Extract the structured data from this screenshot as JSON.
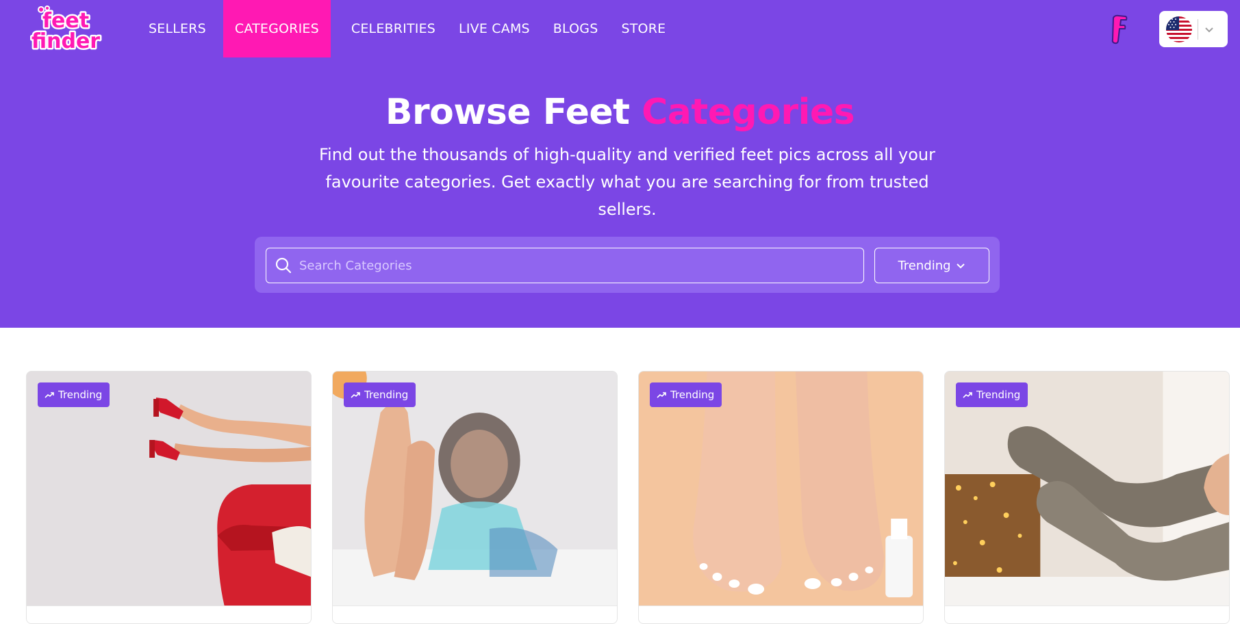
{
  "nav": {
    "logo_text": "feet finder",
    "items": [
      {
        "label": "SELLERS"
      },
      {
        "label": "CATEGORIES",
        "active": true
      },
      {
        "label": "CELEBRITIES"
      },
      {
        "label": "LIVE CAMS"
      },
      {
        "label": "BLOGS"
      },
      {
        "label": "STORE"
      }
    ],
    "language": "US flag"
  },
  "hero": {
    "title_main": "Browse Feet",
    "title_accent": "Categories",
    "subtitle": "Find out the thousands of high-quality and verified feet pics across all your favourite categories. Get exactly what you are searching for from trusted sellers."
  },
  "search": {
    "placeholder": "Search Categories",
    "value": "",
    "sort_label": "Trending"
  },
  "cards": [
    {
      "badge": "Trending",
      "image": "red high heels on red sofa"
    },
    {
      "badge": "Trending",
      "image": "woman relaxing showing soles"
    },
    {
      "badge": "Trending",
      "image": "bare feet with white pedicure"
    },
    {
      "badge": "Trending",
      "image": "feet in knitted wool socks by fireplace"
    }
  ],
  "colors": {
    "brand_purple": "#7b46e5",
    "brand_pink": "#ff19b3",
    "search_panel": "#9065ef"
  }
}
